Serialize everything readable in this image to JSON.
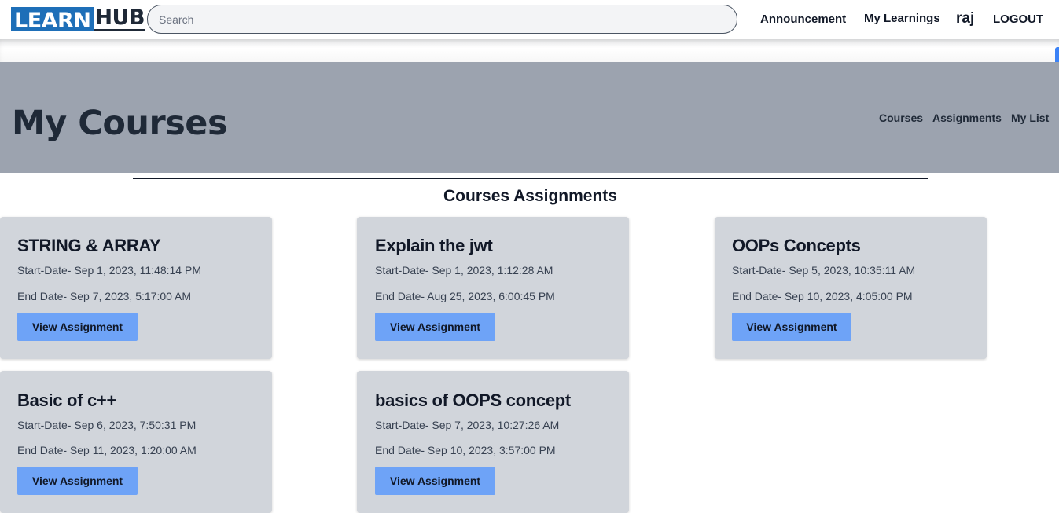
{
  "brand": {
    "learn": "LEARN",
    "hub": "HUB"
  },
  "search": {
    "placeholder": "Search"
  },
  "nav": {
    "announcement": "Announcement",
    "my_learnings": "My Learnings",
    "user": "raj",
    "logout": "LOGOUT"
  },
  "banner": {
    "title": "My Courses",
    "links": [
      "Courses",
      "Assignments",
      "My List"
    ]
  },
  "section": {
    "title": "Courses Assignments"
  },
  "assignments": [
    {
      "title": "STRING & ARRAY",
      "start": "Start-Date- Sep 1, 2023, 11:48:14 PM",
      "end": "End Date- Sep 7, 2023, 5:17:00 AM",
      "button": "View Assignment"
    },
    {
      "title": "Explain the jwt",
      "start": "Start-Date- Sep 1, 2023, 1:12:28 AM",
      "end": "End Date- Aug 25, 2023, 6:00:45 PM",
      "button": "View Assignment"
    },
    {
      "title": "OOPs Concepts",
      "start": "Start-Date- Sep 5, 2023, 10:35:11 AM",
      "end": "End Date- Sep 10, 2023, 4:05:00 PM",
      "button": "View Assignment"
    },
    {
      "title": "Basic of c++",
      "start": "Start-Date- Sep 6, 2023, 7:50:31 PM",
      "end": "End Date- Sep 11, 2023, 1:20:00 AM",
      "button": "View Assignment"
    },
    {
      "title": "basics of OOPS concept",
      "start": "Start-Date- Sep 7, 2023, 10:27:26 AM",
      "end": "End Date- Sep 10, 2023, 3:57:00 PM",
      "button": "View Assignment"
    }
  ],
  "colors": {
    "brand_blue": "#1e6fb8",
    "banner_bg": "#9ca3af",
    "card_bg": "#d1d5db",
    "button_bg": "#6ea3f7"
  }
}
